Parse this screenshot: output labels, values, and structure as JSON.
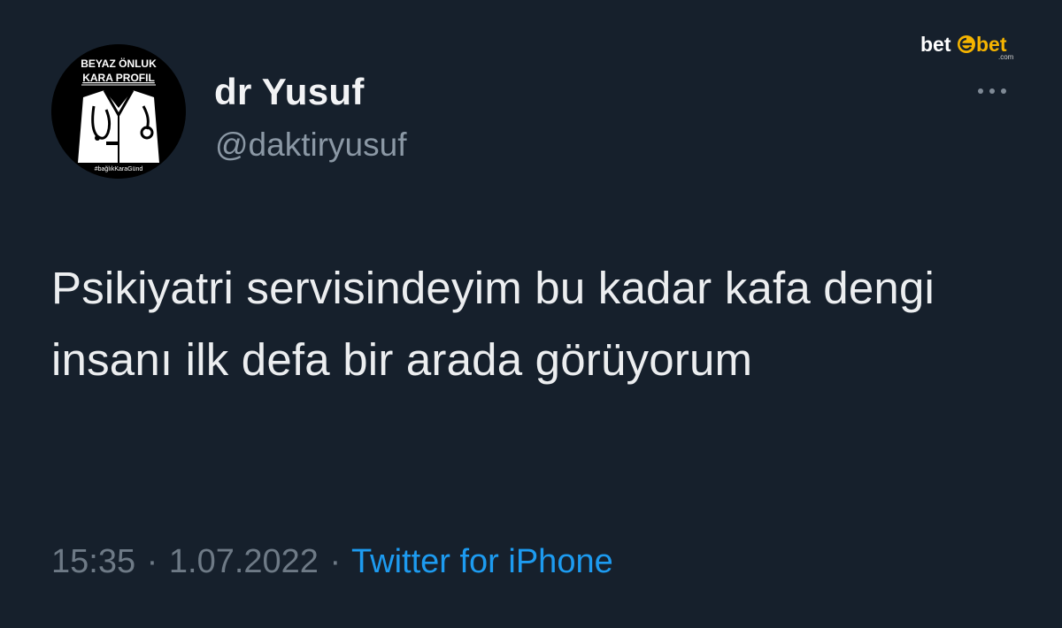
{
  "watermark": {
    "text": "bet",
    "text2": "bet",
    "sub": ".com",
    "accent_color": "#f5b400"
  },
  "tweet": {
    "author": {
      "display_name": "dr Yusuf",
      "handle": "@daktiryusuf",
      "avatar": {
        "top_text": "BEYAZ ÖNLUK",
        "middle_text": "KARA PROFIL",
        "bottom_text": "#bağlıkKaraGünd",
        "icon": "doctor-coat-stethoscope-icon"
      }
    },
    "more_icon": "more-dots-icon",
    "text": "Psikiyatri servisindeyim bu kadar kafa dengi insanı ilk defa bir arada görüyorum",
    "time": "15:35",
    "separator": "·",
    "date": "1.07.2022",
    "source": "Twitter for iPhone"
  },
  "colors": {
    "background": "#16202c",
    "text": "#eceef0",
    "secondary": "#8b98a5",
    "link": "#1d9bf0"
  }
}
